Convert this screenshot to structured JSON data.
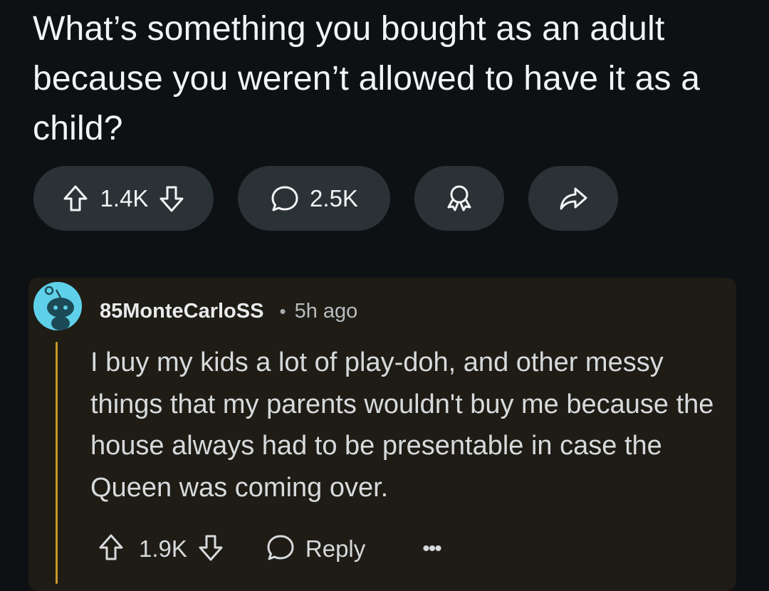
{
  "post": {
    "title": "What’s something you bought as an adult because you weren’t allowed to have it as a child?",
    "vote_count": "1.4K",
    "comment_count": "2.5K"
  },
  "comment": {
    "username": "85MonteCarloSS",
    "separator": "•",
    "time": "5h ago",
    "body": "I buy my kids a lot of play-doh, and other messy things that my parents wouldn't buy me because the house always had to be presentable in case the Queen was coming over.",
    "vote_count": "1.9K",
    "reply_label": "Reply",
    "more_label": "•••"
  },
  "icons": {
    "upvote": "upvote-arrow-icon",
    "downvote": "downvote-arrow-icon",
    "comments": "speech-bubble-icon",
    "award": "award-ribbon-icon",
    "share": "share-arrow-icon"
  },
  "colors": {
    "background": "#0e1113",
    "pill": "#2a3236",
    "comment_card": "#1e1c15",
    "thread_line": "#c79a2c",
    "avatar": "#5fd0ea"
  }
}
